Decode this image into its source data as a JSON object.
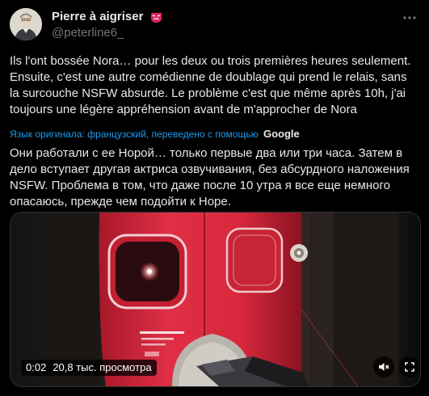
{
  "author": {
    "display_name": "Pierre à aigriser",
    "name_emoji": "mask-emoji",
    "handle": "@peterline6_"
  },
  "tweet": {
    "text_original": "Ils l'ont bossée Nora… pour les deux ou trois premières heures seulement. Ensuite, c'est une autre comédienne de doublage qui prend le relais, sans la surcouche NSFW absurde. Le problème c'est que même après 10h, j'ai toujours une légère appréhension avant de m'approcher de Nora",
    "translation_note": "Язык оригинала: французский, переведено с помощью",
    "translation_provider": "Google",
    "text_translated": "Они работали с ее Норой… только первые два или три часа. Затем в дело вступает другая актриса озвучивания, без абсурдного наложения NSFW. Проблема в том, что даже после 10 утра я все еще немного опасаюсь, прежде чем подойти к Норе."
  },
  "video": {
    "time": "0:02",
    "views": "20,8 тыс. просмотра",
    "mute_icon": "speaker-muted-icon",
    "expand_icon": "expand-icon"
  },
  "colors": {
    "background": "#000000",
    "text": "#e7e9ea",
    "muted": "#71767b",
    "link": "#1d9bf0",
    "door": "#d8283c"
  }
}
